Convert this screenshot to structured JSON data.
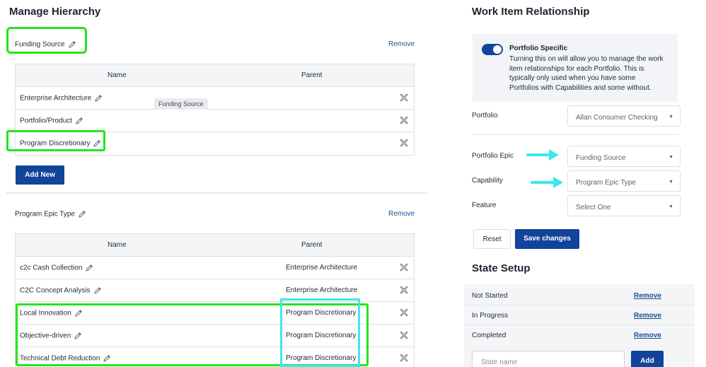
{
  "manage": {
    "title": "Manage Hierarchy",
    "section1": {
      "name": "Funding Source",
      "remove_label": "Remove",
      "col_name": "Name",
      "col_parent": "Parent",
      "rows": [
        {
          "name": "Enterprise Architecture",
          "parent": ""
        },
        {
          "name": "Portfolio/Product",
          "parent": ""
        },
        {
          "name": "Program Discretionary",
          "parent": ""
        }
      ],
      "tooltip": "Funding Source",
      "add_new_label": "Add New"
    },
    "section2": {
      "name": "Program Epic Type",
      "remove_label": "Remove",
      "col_name": "Name",
      "col_parent": "Parent",
      "rows": [
        {
          "name": "c2c Cash Collection",
          "parent": "Enterprise Architecture"
        },
        {
          "name": "C2C Concept Analysis",
          "parent": "Enterprise Architecture"
        },
        {
          "name": "Local Innovation",
          "parent": "Program Discretionary"
        },
        {
          "name": "Objective-driven",
          "parent": "Program Discretionary"
        },
        {
          "name": "Technical Debt Reduction",
          "parent": "Program Discretionary"
        }
      ]
    }
  },
  "relationship": {
    "title": "Work Item Relationship",
    "portfolio_specific": {
      "title": "Portfolio Specific",
      "description_lines": [
        "Turning this on will allow you to manage the work",
        "item relationships for each Portfolio. This is",
        "typically only used when you have some",
        "Portfolios with Capabilities and some without."
      ],
      "enabled": true
    },
    "portfolio_label": "Portfolio",
    "portfolio_value": "Allan Consumer Checking",
    "fields": [
      {
        "label": "Portfolio Epic",
        "value": "Funding Source"
      },
      {
        "label": "Capability",
        "value": "Program Epic Type"
      },
      {
        "label": "Feature",
        "value": "Select One"
      }
    ],
    "reset_label": "Reset",
    "save_label": "Save changes"
  },
  "state_setup": {
    "title": "State Setup",
    "states": [
      {
        "name": "Not Started",
        "action": "Remove"
      },
      {
        "name": "In Progress",
        "action": "Remove"
      },
      {
        "name": "Completed",
        "action": "Remove"
      }
    ],
    "input_placeholder": "State name",
    "add_label": "Add"
  },
  "colors": {
    "primary": "#11449a",
    "link": "#1d4f91",
    "highlight_green": "#22e61c",
    "highlight_cyan": "#3ee7f0",
    "arrow_cyan": "#3ee7f0"
  }
}
